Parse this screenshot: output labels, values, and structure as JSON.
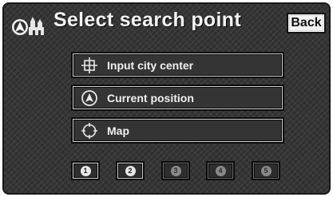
{
  "header": {
    "title": "Select search point",
    "back_label": "Back"
  },
  "menu": [
    {
      "label": "Input city center",
      "icon": "crosshair-icon"
    },
    {
      "label": "Current position",
      "icon": "current-position-icon"
    },
    {
      "label": "Map",
      "icon": "map-target-icon"
    }
  ],
  "memory_points": [
    {
      "label": "1",
      "enabled": true
    },
    {
      "label": "2",
      "enabled": true
    },
    {
      "label": "3",
      "enabled": false
    },
    {
      "label": "4",
      "enabled": false
    },
    {
      "label": "5",
      "enabled": false
    }
  ]
}
